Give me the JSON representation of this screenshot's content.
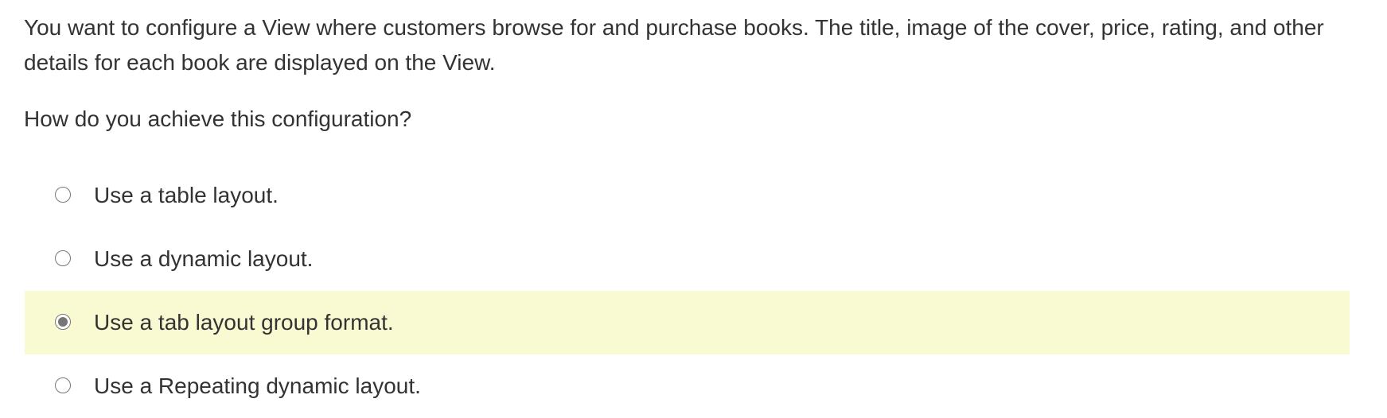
{
  "question": {
    "text": "You want to configure a View where customers browse for and purchase books. The title, image of the cover, price, rating, and other details for each book are displayed on the View.",
    "prompt": "How do you achieve this configuration?"
  },
  "options": [
    {
      "label": "Use a table layout.",
      "selected": false
    },
    {
      "label": "Use a dynamic layout.",
      "selected": false
    },
    {
      "label": "Use a tab layout group format.",
      "selected": true
    },
    {
      "label": "Use a Repeating dynamic layout.",
      "selected": false
    }
  ],
  "colors": {
    "selected_background": "#fafad2",
    "text": "#333333",
    "radio_border": "#777777",
    "radio_dot": "#767676"
  }
}
